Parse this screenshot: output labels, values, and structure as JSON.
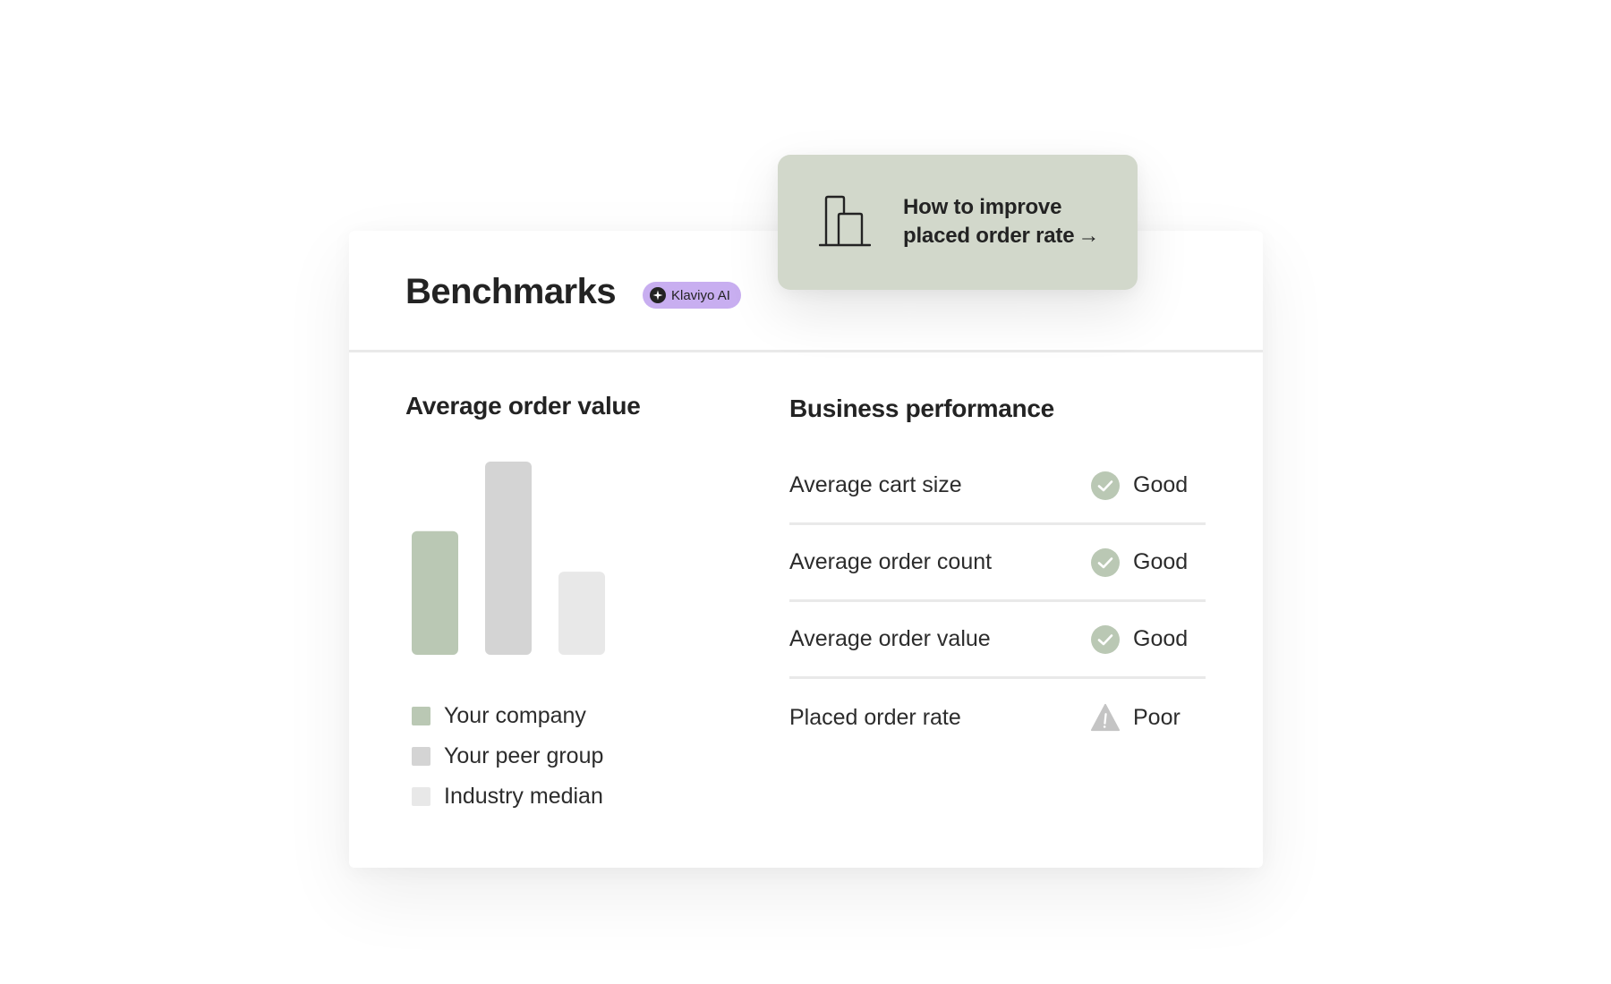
{
  "header": {
    "title": "Benchmarks",
    "badge": {
      "label": "Klaviyo AI",
      "icon": "sparkle-icon",
      "color": "#c8aef0"
    }
  },
  "popover": {
    "icon": "buildings-icon",
    "line1": "How to improve",
    "line2": "placed order rate",
    "arrow": "→",
    "background": "#d2d8cb"
  },
  "average_order_value": {
    "title": "Average order value",
    "legend": [
      {
        "label": "Your company",
        "color": "#bac8b4"
      },
      {
        "label": "Your peer group",
        "color": "#d4d4d4"
      },
      {
        "label": "Industry median",
        "color": "#e8e8e8"
      }
    ]
  },
  "chart_data": {
    "type": "bar",
    "title": "Average order value",
    "categories": [
      "Your company",
      "Your peer group",
      "Industry median"
    ],
    "values": [
      64,
      100,
      43
    ],
    "value_note": "relative heights; no axis shown (peer group = 100)",
    "colors": [
      "#bac8b4",
      "#d4d4d4",
      "#e8e8e8"
    ],
    "xlabel": "",
    "ylabel": "",
    "ylim": [
      0,
      100
    ],
    "grid": false,
    "legend": "bottom"
  },
  "business_performance": {
    "title": "Business performance",
    "rows": [
      {
        "label": "Average cart size",
        "status": "Good",
        "icon": "check-circle-icon"
      },
      {
        "label": "Average order count",
        "status": "Good",
        "icon": "check-circle-icon"
      },
      {
        "label": "Average order value",
        "status": "Good",
        "icon": "check-circle-icon"
      },
      {
        "label": "Placed order rate",
        "status": "Poor",
        "icon": "warning-triangle-icon"
      }
    ],
    "status_colors": {
      "Good": "#bac8b4",
      "Poor": "#c4c4c4"
    }
  }
}
